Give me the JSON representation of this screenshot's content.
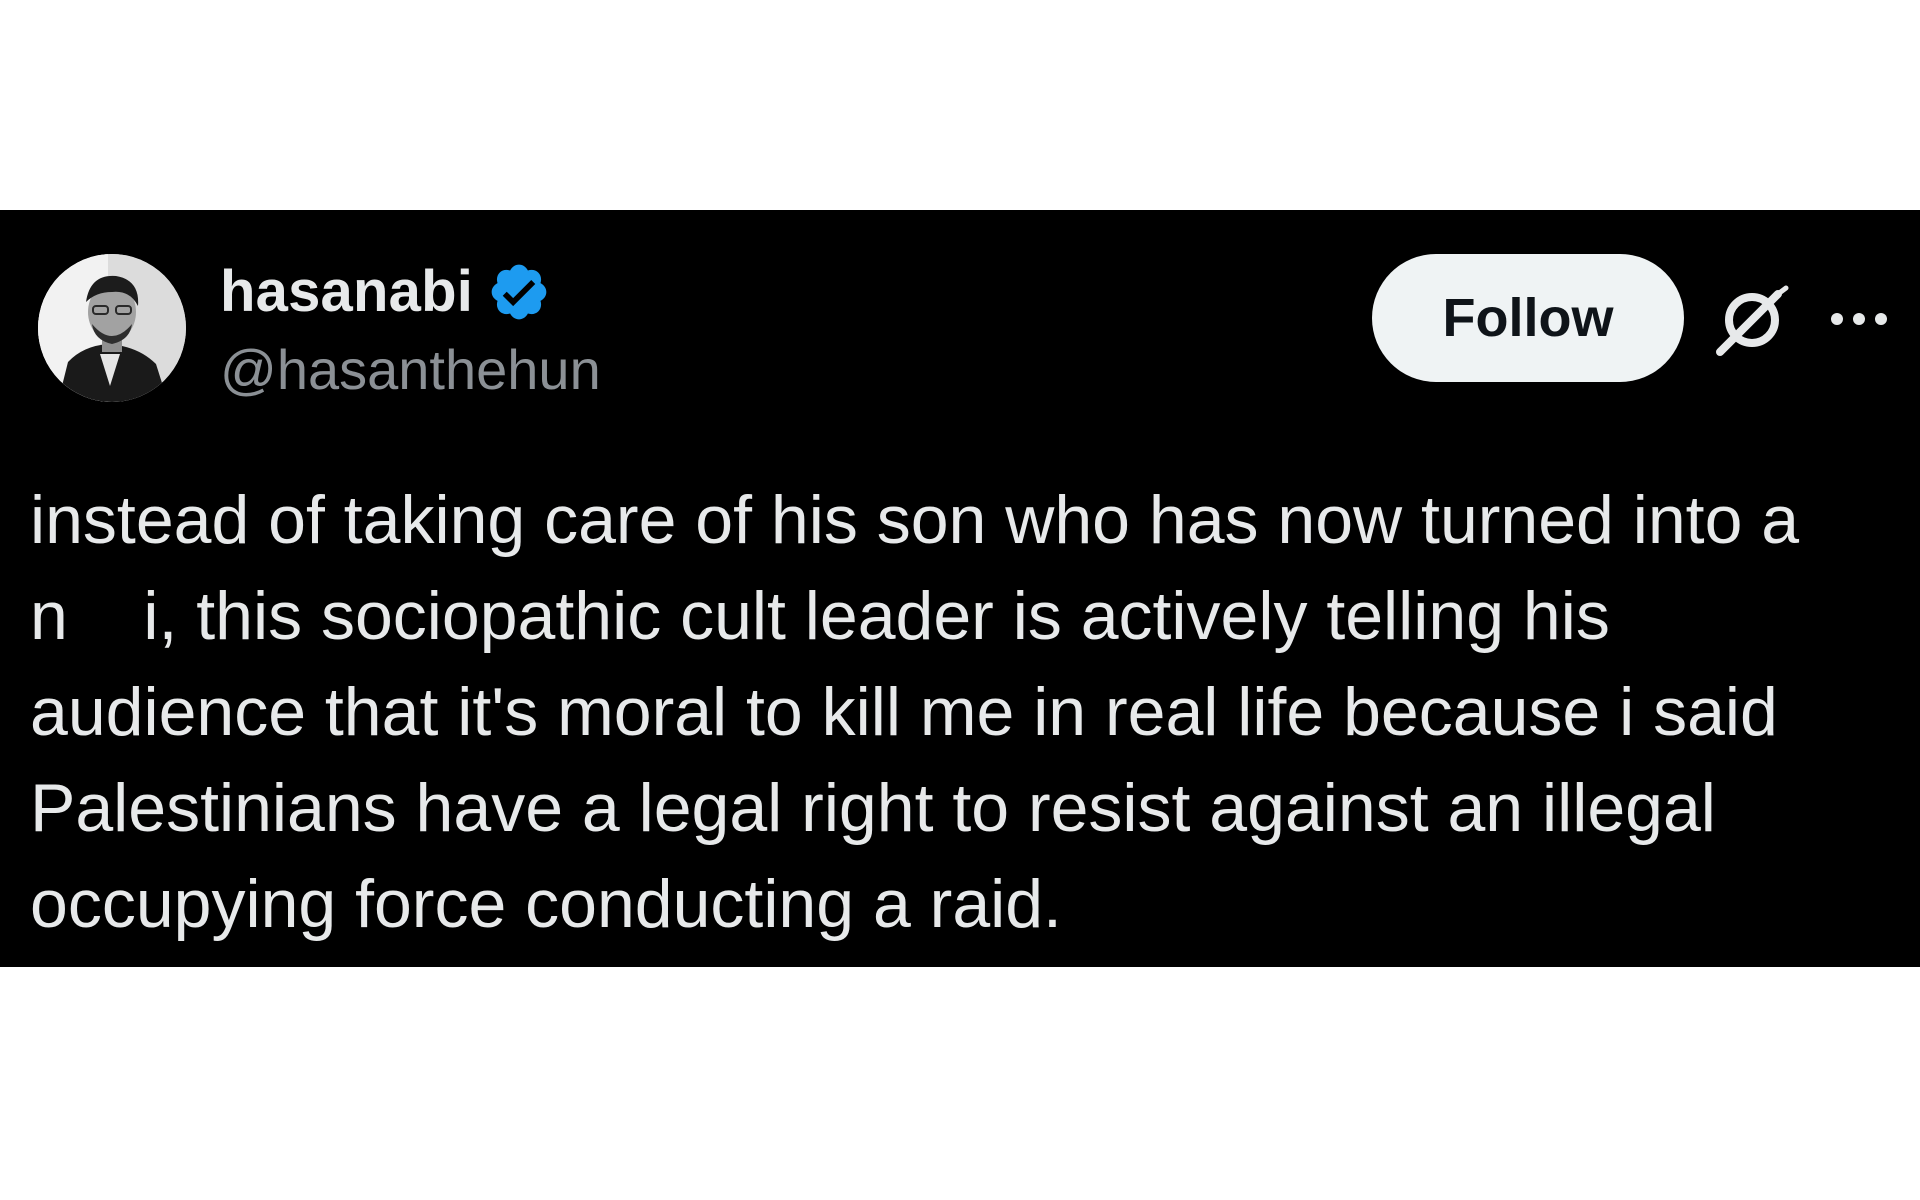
{
  "tweet": {
    "author": {
      "display_name": "hasanabi",
      "handle": "@hasanthehun",
      "verified": true,
      "verified_color": "#1d9bf0"
    },
    "follow_label": "Follow",
    "icons": {
      "verified": "verified-badge-icon",
      "grok": "grok-icon",
      "more": "more-options-icon"
    },
    "text_lines": [
      "instead of taking care of his son who has now turned into a",
      "n    i, this sociopathic cult leader is actively telling his",
      "audience that it's moral to kill me in real life because i said",
      "Palestinians have a legal right to resist against an illegal",
      "occupying force conducting a raid."
    ]
  }
}
